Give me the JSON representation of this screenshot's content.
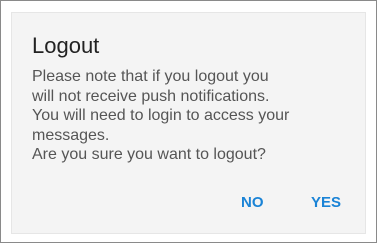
{
  "dialog": {
    "title": "Logout",
    "message": "Please note that if you logout you\nwill not receive push notifications.\nYou will need to login to access your\nmessages.\nAre you sure you want to logout?",
    "buttons": {
      "no_label": "NO",
      "yes_label": "YES"
    },
    "accent_color": "#1a83d6"
  }
}
